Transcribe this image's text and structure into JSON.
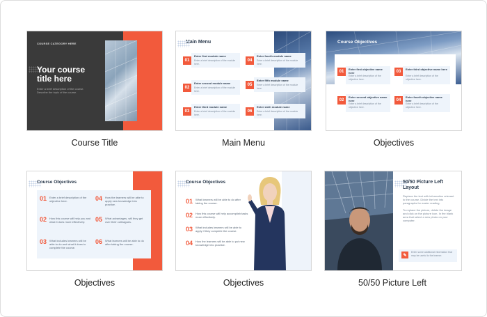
{
  "cards": [
    {
      "caption": "Course Title"
    },
    {
      "caption": "Main Menu"
    },
    {
      "caption": "Objectives"
    },
    {
      "caption": "Objectives"
    },
    {
      "caption": "Objectives"
    },
    {
      "caption": "50/50 Picture Left"
    }
  ],
  "course_title": {
    "category": "COURSE CATEGORY HERE",
    "title": "Your course title here",
    "desc": "Enter a brief description of the course. Describe the topic of the course."
  },
  "main_menu": {
    "heading": "Main Menu",
    "modules": [
      {
        "num": "01",
        "name": "Enter first module name",
        "desc": "Enter a brief description of the module here."
      },
      {
        "num": "02",
        "name": "Enter second module name",
        "desc": "Enter a brief description of the module here."
      },
      {
        "num": "03",
        "name": "Enter third module name",
        "desc": "Enter a brief description of the module here."
      },
      {
        "num": "04",
        "name": "Enter fourth module name",
        "desc": "Enter a brief description of the module here."
      },
      {
        "num": "05",
        "name": "Enter fifth module name",
        "desc": "Enter a brief description of the module here."
      },
      {
        "num": "06",
        "name": "Enter sixth module name",
        "desc": "Enter a brief description of the module here."
      }
    ]
  },
  "objectives1": {
    "heading": "Course Objectives",
    "items": [
      {
        "num": "01",
        "name": "Enter first objective name here",
        "desc": "Enter a brief description of the objective here."
      },
      {
        "num": "02",
        "name": "Enter second objective name here",
        "desc": "Enter a brief description of the objective here."
      },
      {
        "num": "03",
        "name": "Enter third objective name here",
        "desc": "Enter a brief description of the objective here."
      },
      {
        "num": "04",
        "name": "Enter fourth objective name here",
        "desc": "Enter a brief description of the objective here."
      }
    ]
  },
  "objectives2": {
    "heading": "Course Objectives",
    "items": [
      {
        "num": "01",
        "desc": "Enter a brief description of the objective here."
      },
      {
        "num": "02",
        "desc": "How this course will help you and what it does more effectively."
      },
      {
        "num": "03",
        "desc": "What includes learners will be able to do and what it does to complete the course."
      },
      {
        "num": "04",
        "desc": "How the learners will be able to apply new knowledge into practice."
      },
      {
        "num": "05",
        "desc": "What advantages, will they get over their colleagues."
      },
      {
        "num": "06",
        "desc": "What learners will be able to do after taking the course."
      }
    ]
  },
  "objectives3": {
    "heading": "Course Objectives",
    "items": [
      {
        "num": "01",
        "desc": "What learners will be able to do after taking the course."
      },
      {
        "num": "02",
        "desc": "How this course will help accomplish tasks more effectively."
      },
      {
        "num": "03",
        "desc": "What includes learners will be able to apply if they complete the course."
      },
      {
        "num": "04",
        "desc": "How the learners will be able to put new knowledge into practice."
      }
    ]
  },
  "picture_left": {
    "heading": "50/50 Picture Left Layout",
    "body1": "Replace the text with information relevant to the course. Divide the text into paragraphs for easier reading.",
    "body2": "To replace the picture, delete the image and click on the picture icon. In the blank area that select a new photo on your computer.",
    "note": "Enter some additional information that may be useful to the learner."
  }
}
